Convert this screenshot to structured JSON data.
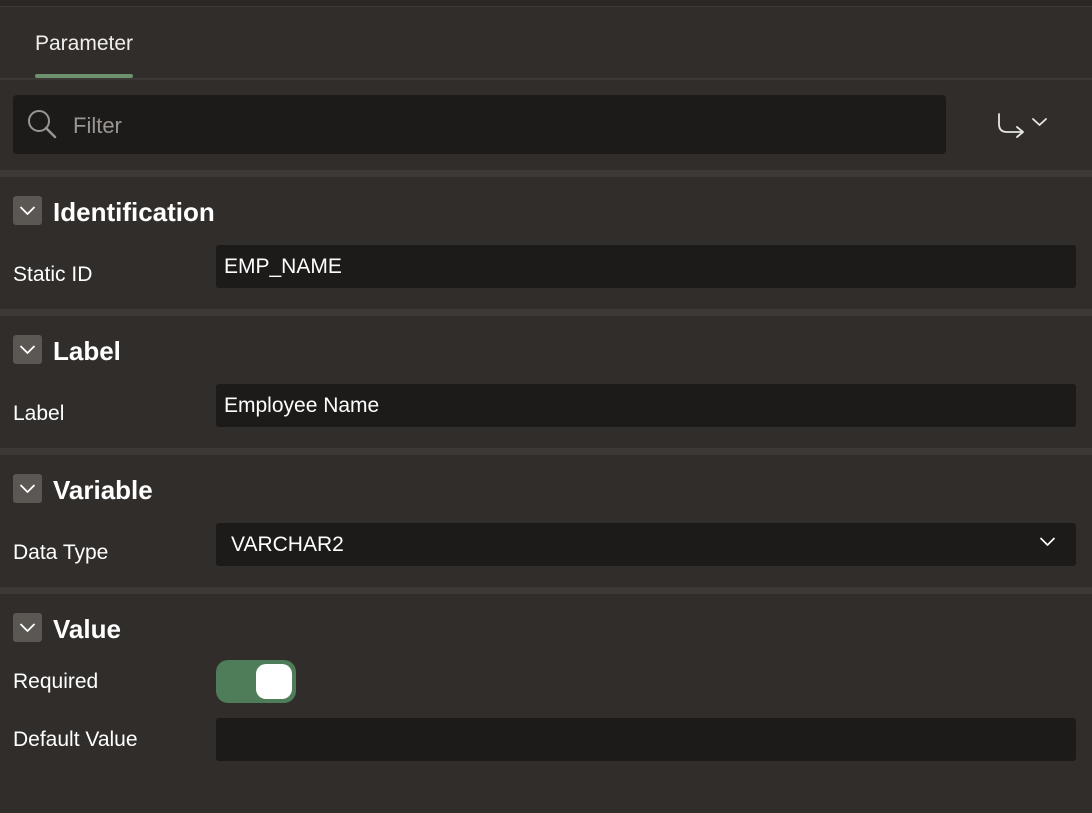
{
  "tabs": [
    {
      "label": "Parameter",
      "active": true
    }
  ],
  "filter": {
    "placeholder": "Filter",
    "value": ""
  },
  "toolbar": {
    "goto_icon": "goto-arrow-icon"
  },
  "sections": {
    "identification": {
      "title": "Identification",
      "static_id": {
        "label": "Static ID",
        "value": "EMP_NAME"
      }
    },
    "label": {
      "title": "Label",
      "label_field": {
        "label": "Label",
        "value": "Employee Name"
      }
    },
    "variable": {
      "title": "Variable",
      "data_type": {
        "label": "Data Type",
        "value": "VARCHAR2"
      }
    },
    "value": {
      "title": "Value",
      "required": {
        "label": "Required",
        "on": true
      },
      "default_value": {
        "label": "Default Value",
        "value": ""
      }
    }
  },
  "colors": {
    "accent": "#6e9270",
    "toggle_on": "#4f7d5a",
    "background": "#312d2a",
    "field": "#1c1b1a"
  }
}
